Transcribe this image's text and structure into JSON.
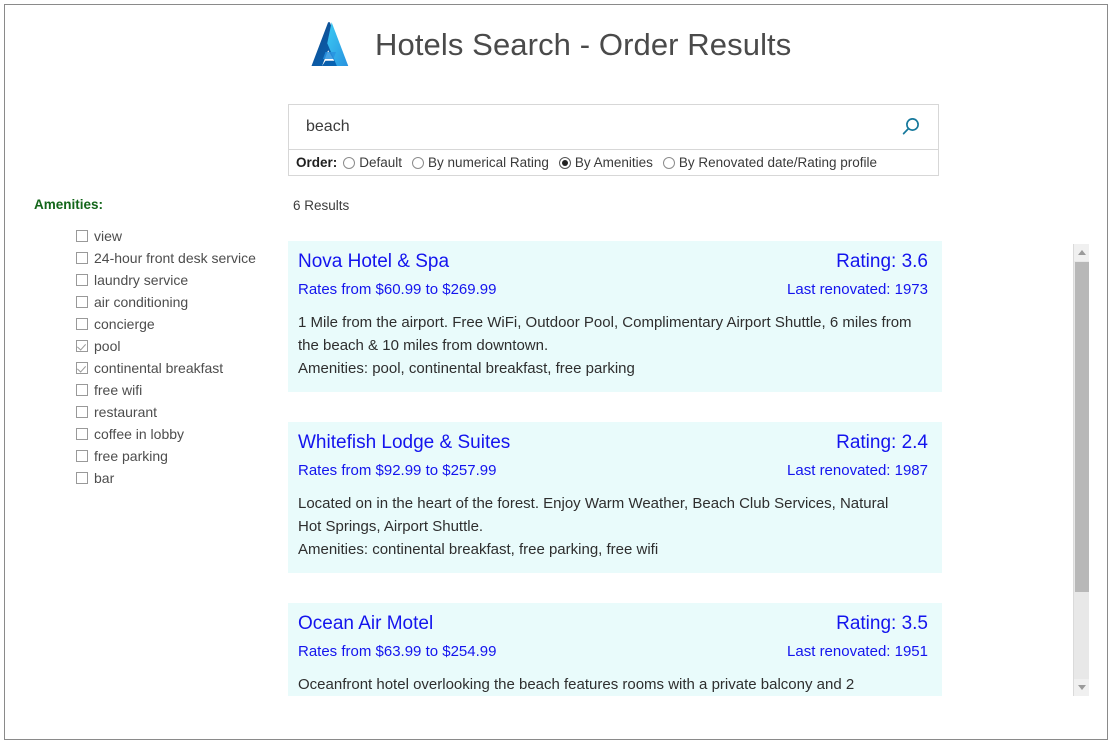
{
  "header": {
    "title": "Hotels Search - Order Results",
    "logo_icon": "azure-logo-icon"
  },
  "search": {
    "value": "beach",
    "placeholder": "",
    "search_icon": "search-icon",
    "order_label": "Order:",
    "order_options": [
      {
        "label": "Default",
        "selected": false
      },
      {
        "label": "By numerical Rating",
        "selected": false
      },
      {
        "label": "By Amenities",
        "selected": true
      },
      {
        "label": "By Renovated date/Rating profile",
        "selected": false
      }
    ]
  },
  "sidebar": {
    "title": "Amenities:",
    "items": [
      {
        "label": "view",
        "checked": false
      },
      {
        "label": "24-hour front desk service",
        "checked": false
      },
      {
        "label": "laundry service",
        "checked": false
      },
      {
        "label": "air conditioning",
        "checked": false
      },
      {
        "label": "concierge",
        "checked": false
      },
      {
        "label": "pool",
        "checked": true
      },
      {
        "label": "continental breakfast",
        "checked": true
      },
      {
        "label": "free wifi",
        "checked": false
      },
      {
        "label": "restaurant",
        "checked": false
      },
      {
        "label": "coffee in lobby",
        "checked": false
      },
      {
        "label": "free parking",
        "checked": false
      },
      {
        "label": "bar",
        "checked": false
      }
    ]
  },
  "results": {
    "count_text": "6 Results",
    "cards": [
      {
        "name": "Nova Hotel & Spa",
        "rating": "Rating: 3.6",
        "rates": "Rates from $60.99 to $269.99",
        "renovated": "Last renovated: 1973",
        "description": "1 Mile from the airport.  Free WiFi, Outdoor Pool, Complimentary Airport Shuttle, 6 miles from the beach & 10 miles from downtown.",
        "amenities": "Amenities: pool, continental breakfast, free parking"
      },
      {
        "name": "Whitefish Lodge & Suites",
        "rating": "Rating: 2.4",
        "rates": "Rates from $92.99 to $257.99",
        "renovated": "Last renovated: 1987",
        "description": "Located on in the heart of the forest. Enjoy Warm Weather, Beach Club Services, Natural Hot Springs, Airport Shuttle.",
        "amenities": "Amenities: continental breakfast, free parking, free wifi"
      },
      {
        "name": "Ocean Air Motel",
        "rating": "Rating: 3.5",
        "rates": "Rates from $63.99 to $254.99",
        "renovated": "Last renovated: 1951",
        "description": "Oceanfront hotel overlooking the beach features rooms with a private balcony and 2",
        "amenities": ""
      }
    ]
  },
  "scrollbar": {
    "up_icon": "chevron-up-icon",
    "down_icon": "chevron-down-icon"
  },
  "colors": {
    "accent": "#0078d4",
    "link": "#1414ee",
    "card_bg": "#e9fbfb",
    "sidebar_heading": "#13661a"
  }
}
